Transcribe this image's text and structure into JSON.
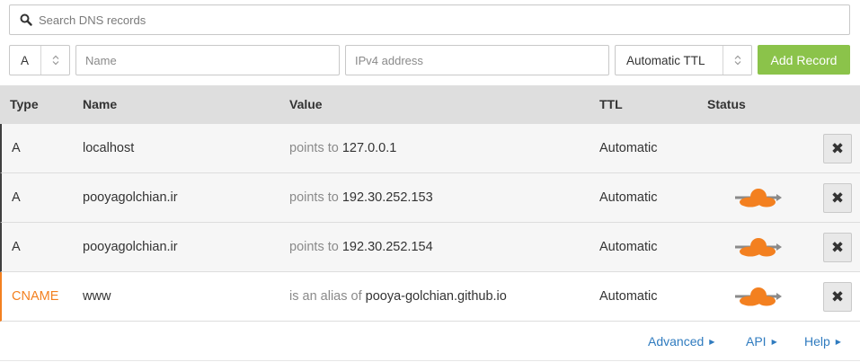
{
  "search": {
    "placeholder": "Search DNS records"
  },
  "form": {
    "type_value": "A",
    "name_placeholder": "Name",
    "value_placeholder": "IPv4 address",
    "ttl_value": "Automatic TTL",
    "add_label": "Add Record"
  },
  "table": {
    "headers": {
      "type": "Type",
      "name": "Name",
      "value": "Value",
      "ttl": "TTL",
      "status": "Status"
    },
    "rows": [
      {
        "type": "A",
        "name": "localhost",
        "value_prefix": "points to",
        "value": "127.0.0.1",
        "ttl": "Automatic",
        "proxied": false,
        "delete": "✖"
      },
      {
        "type": "A",
        "name": "pooyagolchian.ir",
        "value_prefix": "points to",
        "value": "192.30.252.153",
        "ttl": "Automatic",
        "proxied": true,
        "delete": "✖"
      },
      {
        "type": "A",
        "name": "pooyagolchian.ir",
        "value_prefix": "points to",
        "value": "192.30.252.154",
        "ttl": "Automatic",
        "proxied": true,
        "delete": "✖"
      },
      {
        "type": "CNAME",
        "name": "www",
        "value_prefix": "is an alias of",
        "value": "pooya-golchian.github.io",
        "ttl": "Automatic",
        "proxied": true,
        "delete": "✖"
      }
    ]
  },
  "footer": {
    "advanced": "Advanced",
    "api": "API",
    "help": "Help",
    "caret": "▶"
  },
  "colors": {
    "accent_green": "#8bc34a",
    "cloud_orange": "#f38020",
    "link_blue": "#2f7bbf"
  },
  "icons": {
    "search": "search-icon",
    "stepper": "up-down-arrows-icon",
    "proxy": "orange-cloud-icon",
    "delete": "close-icon"
  }
}
